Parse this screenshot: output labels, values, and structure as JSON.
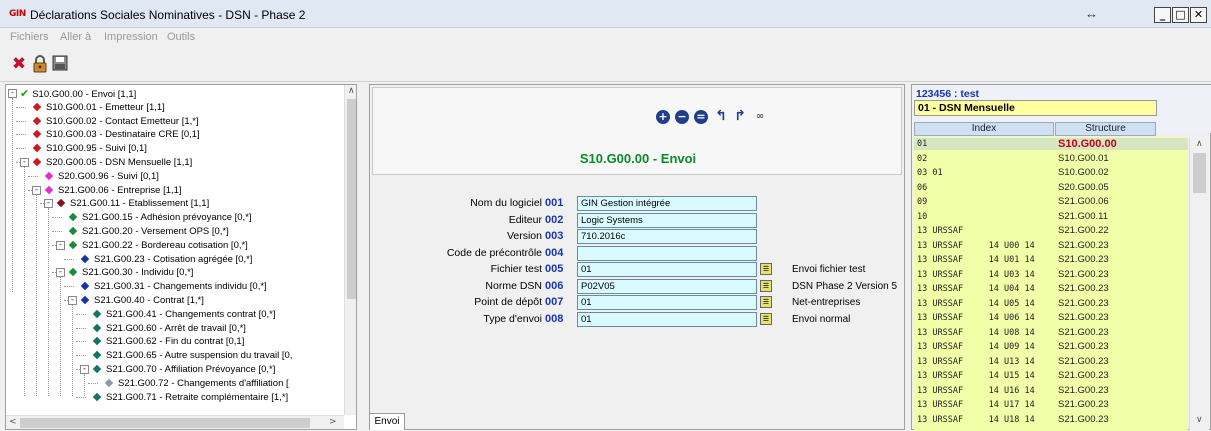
{
  "window": {
    "title": "Déclarations Sociales Nominatives - DSN - Phase 2",
    "app_icon_text": "GIN",
    "minimize": "_",
    "maximize": "□",
    "close": "✕",
    "resize_glyph": "↔"
  },
  "menu": [
    "Fichiers",
    "Aller à",
    "Impression",
    "Outils"
  ],
  "toolbar": {
    "icons": [
      "delete-icon",
      "lock-icon",
      "save-icon"
    ]
  },
  "tree": {
    "items": [
      {
        "label": "S10.G00.00 - Envoi [1,1]",
        "level": 0,
        "marker": "check",
        "box": "-"
      },
      {
        "label": "S10.G00.01 - Emetteur [1,1]",
        "level": 1,
        "marker": "red"
      },
      {
        "label": "S10.G00.02 - Contact Emetteur [1,*]",
        "level": 1,
        "marker": "red"
      },
      {
        "label": "S10.G00.03 - Destinataire CRE [0,1]",
        "level": 1,
        "marker": "red"
      },
      {
        "label": "S10.G00.95 - Suivi [0,1]",
        "level": 1,
        "marker": "red"
      },
      {
        "label": "S20.G00.05 - DSN Mensuelle [1,1]",
        "level": 1,
        "marker": "red",
        "box": "-"
      },
      {
        "label": "S20.G00.96 - Suivi [0,1]",
        "level": 2,
        "marker": "magenta"
      },
      {
        "label": "S21.G00.06 - Entreprise [1,1]",
        "level": 2,
        "marker": "magenta",
        "box": "-"
      },
      {
        "label": "S21.G00.11 - Etablissement [1,1]",
        "level": 3,
        "marker": "darkred",
        "box": "-"
      },
      {
        "label": "S21.G00.15 - Adhésion prévoyance [0,*]",
        "level": 4,
        "marker": "green"
      },
      {
        "label": "S21.G00.20 - Versement OPS [0,*]",
        "level": 4,
        "marker": "green"
      },
      {
        "label": "S21.G00.22 - Bordereau cotisation [0,*]",
        "level": 4,
        "marker": "green",
        "box": "-"
      },
      {
        "label": "S21.G00.23 - Cotisation agrégée [0,*]",
        "level": 5,
        "marker": "blue"
      },
      {
        "label": "S21.G00.30 - Individu [0,*]",
        "level": 4,
        "marker": "green",
        "box": "-"
      },
      {
        "label": "S21.G00.31 - Changements individu [0,*]",
        "level": 5,
        "marker": "blue"
      },
      {
        "label": "S21.G00.40 - Contrat [1,*]",
        "level": 5,
        "marker": "blue",
        "box": "-"
      },
      {
        "label": "S21.G00.41 - Changements contrat [0,*]",
        "level": 6,
        "marker": "teal"
      },
      {
        "label": "S21.G00.60 - Arrêt de travail [0,*]",
        "level": 6,
        "marker": "teal"
      },
      {
        "label": "S21.G00.62 - Fin du contrat [0,1]",
        "level": 6,
        "marker": "teal"
      },
      {
        "label": "S21.G00.65 - Autre suspension du travail [0,",
        "level": 6,
        "marker": "teal"
      },
      {
        "label": "S21.G00.70 - Affiliation Prévoyance [0,*]",
        "level": 6,
        "marker": "teal",
        "box": "-"
      },
      {
        "label": "S21.G00.72 - Changements d'affiliation [",
        "level": 7,
        "marker": "gray"
      },
      {
        "label": "S21.G00.71 - Retraite complémentaire [1,*]",
        "level": 6,
        "marker": "teal"
      }
    ]
  },
  "middle": {
    "section_title": "S10.G00.00 - Envoi",
    "nav_icons": [
      "add-icon",
      "remove-icon",
      "minus-icon",
      "undo-icon",
      "redo-icon",
      "find-icon"
    ],
    "fields": [
      {
        "label": "Nom du logiciel",
        "code": "001",
        "value": "GIN Gestion intégrée",
        "lookup": false,
        "desc": ""
      },
      {
        "label": "Editeur",
        "code": "002",
        "value": "Logic Systems",
        "lookup": false,
        "desc": ""
      },
      {
        "label": "Version",
        "code": "003",
        "value": "710.2016c",
        "lookup": false,
        "desc": ""
      },
      {
        "label": "Code de précontrôle",
        "code": "004",
        "value": "",
        "lookup": false,
        "desc": ""
      },
      {
        "label": "Fichier test",
        "code": "005",
        "value": "01",
        "lookup": true,
        "desc": "Envoi fichier test"
      },
      {
        "label": "Norme DSN",
        "code": "006",
        "value": "P02V05",
        "lookup": true,
        "desc": "DSN Phase 2 Version 5"
      },
      {
        "label": "Point de dépôt",
        "code": "007",
        "value": "01",
        "lookup": true,
        "desc": "Net-entreprises"
      },
      {
        "label": "Type d'envoi",
        "code": "008",
        "value": "01",
        "lookup": true,
        "desc": "Envoi normal"
      }
    ],
    "tab_label": "Envoi"
  },
  "right": {
    "title": "123456 : test",
    "subtitle": "01 - DSN Mensuelle",
    "col_index": "Index",
    "col_structure": "Structure",
    "rows": [
      {
        "index": "01",
        "structure": "S10.G00.00",
        "selected": true
      },
      {
        "index": "02",
        "structure": "S10.G00.01"
      },
      {
        "index": "03 01",
        "structure": "S10.G00.02"
      },
      {
        "index": "06",
        "structure": "S20.G00.05"
      },
      {
        "index": "09",
        "structure": "S21.G00.06"
      },
      {
        "index": "10",
        "structure": "S21.G00.11"
      },
      {
        "index": "13 URSSAF",
        "structure": "S21.G00.22"
      },
      {
        "index": "13 URSSAF     14 U00 14",
        "structure": "S21.G00.23"
      },
      {
        "index": "13 URSSAF     14 U01 14",
        "structure": "S21.G00.23"
      },
      {
        "index": "13 URSSAF     14 U03 14",
        "structure": "S21.G00.23"
      },
      {
        "index": "13 URSSAF     14 U04 14",
        "structure": "S21.G00.23"
      },
      {
        "index": "13 URSSAF     14 U05 14",
        "structure": "S21.G00.23"
      },
      {
        "index": "13 URSSAF     14 U06 14",
        "structure": "S21.G00.23"
      },
      {
        "index": "13 URSSAF     14 U08 14",
        "structure": "S21.G00.23"
      },
      {
        "index": "13 URSSAF     14 U09 14",
        "structure": "S21.G00.23"
      },
      {
        "index": "13 URSSAF     14 U13 14",
        "structure": "S21.G00.23"
      },
      {
        "index": "13 URSSAF     14 U15 14",
        "structure": "S21.G00.23"
      },
      {
        "index": "13 URSSAF     14 U16 14",
        "structure": "S21.G00.23"
      },
      {
        "index": "13 URSSAF     14 U17 14",
        "structure": "S21.G00.23"
      },
      {
        "index": "13 URSSAF     14 U18 14",
        "structure": "S21.G00.23"
      }
    ]
  }
}
